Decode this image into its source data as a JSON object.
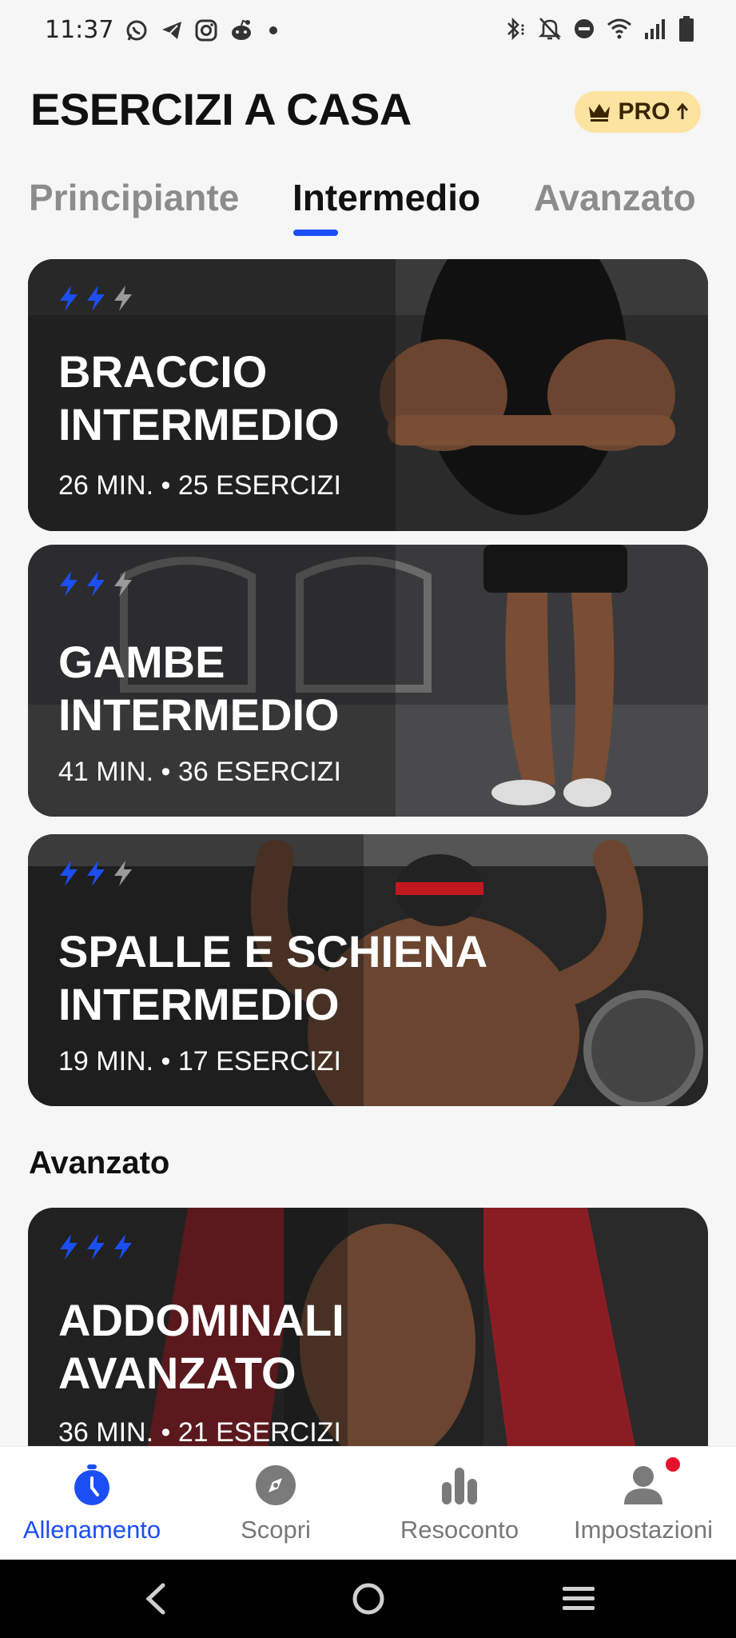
{
  "status_bar": {
    "time": "11:37",
    "app_icons": [
      "whatsapp-icon",
      "telegram-icon",
      "instagram-icon",
      "reddit-icon",
      "more-notifications-dot"
    ],
    "system_icons": [
      "bluetooth-icon",
      "mute-icon",
      "dnd-icon",
      "wifi-icon",
      "signal-icon",
      "battery-icon"
    ]
  },
  "header": {
    "title": "ESERCIZI A CASA",
    "pro_label": "PRO"
  },
  "tabs": [
    {
      "label": "Principiante",
      "active": false
    },
    {
      "label": "Intermedio",
      "active": true
    },
    {
      "label": "Avanzato",
      "active": false
    }
  ],
  "workouts": [
    {
      "title_line1": "BRACCIO",
      "title_line2": "INTERMEDIO",
      "meta": "26 MIN. • 25 ESERCIZI",
      "level": 2,
      "level_max": 3
    },
    {
      "title_line1": "GAMBE",
      "title_line2": "INTERMEDIO",
      "meta": "41 MIN. • 36 ESERCIZI",
      "level": 2,
      "level_max": 3
    },
    {
      "title_line1": "SPALLE E SCHIENA",
      "title_line2": "INTERMEDIO",
      "meta": "19 MIN. • 17 ESERCIZI",
      "level": 2,
      "level_max": 3
    }
  ],
  "advanced_section": {
    "title": "Avanzato",
    "workouts": [
      {
        "title_line1": "ADDOMINALI",
        "title_line2": "AVANZATO",
        "meta": "36 MIN. • 21 ESERCIZI",
        "level": 3,
        "level_max": 3
      }
    ]
  },
  "bottom_nav": [
    {
      "label": "Allenamento",
      "icon": "stopwatch-icon",
      "active": true
    },
    {
      "label": "Scopri",
      "icon": "compass-icon",
      "active": false
    },
    {
      "label": "Resoconto",
      "icon": "bar-chart-icon",
      "active": false
    },
    {
      "label": "Impostazioni",
      "icon": "profile-icon",
      "active": false,
      "badge": true
    }
  ],
  "colors": {
    "accent": "#1b4ff5",
    "pro_badge_bg": "#fde3a0",
    "notification_dot": "#e8112d",
    "inactive_bolt": "#9a9a9a"
  }
}
